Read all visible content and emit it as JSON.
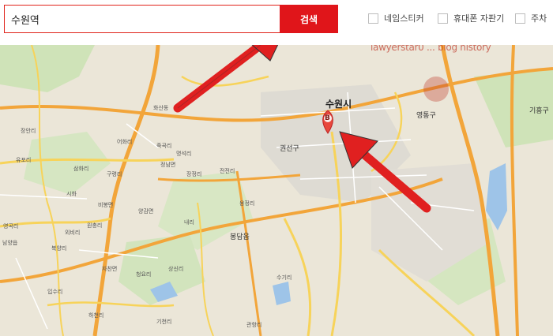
{
  "search": {
    "value": "수원역",
    "button_label": "검색"
  },
  "filters": [
    {
      "label": "네임스티커",
      "checked": false
    },
    {
      "label": "휴대폰 자판기",
      "checked": false
    },
    {
      "label": "주차",
      "checked": false
    }
  ],
  "map": {
    "marker_label": "B",
    "watermark": "lawyerstar0 ... blog history",
    "places": {
      "suwon": "수원시",
      "gwonseon": "권선구",
      "yeongtong": "영통구",
      "giheung": "기흥구",
      "bongdam": "봉담읍",
      "jangan": "장안리",
      "yuri": "유포리",
      "yeonggok": "영곡리",
      "namyang": "남양읍",
      "sihwa": "시화",
      "eohwa": "어화리",
      "jukgok": "죽곡리",
      "samhwa": "삼화리",
      "jeongnam": "정남면",
      "myeongseok": "명석리",
      "jangjeong": "장정리",
      "hwasan": "화산동",
      "sujeong": "수정리",
      "haesan": "해산리",
      "napyeong": "나평리",
      "guryeong": "구령리",
      "wonchoong": "원충리",
      "oeb": "외비리",
      "bibong": "비봉면",
      "yanggam": "양감면",
      "ipsu": "입수리",
      "bukyang": "북양리",
      "jachan": "자찬면",
      "cheongyeong": "청요리",
      "sangsin": "상신리",
      "gwanhang": "관항리",
      "hacheon": "하천리",
      "guhyeon": "구현리",
      "dongsu": "동수리",
      "sumokri": "수목리",
      "giseon": "기천리",
      "jeonjeon": "전전리",
      "nari": "내리",
      "yongjeong": "용정리",
      "anil": "안일리",
      "suggiri": "수기리",
      "songseok": "송석리"
    }
  },
  "colors": {
    "accent": "#e0151a",
    "road_major": "#f2a53a",
    "road_minor": "#f7d35a",
    "arrow": "#e02020"
  }
}
